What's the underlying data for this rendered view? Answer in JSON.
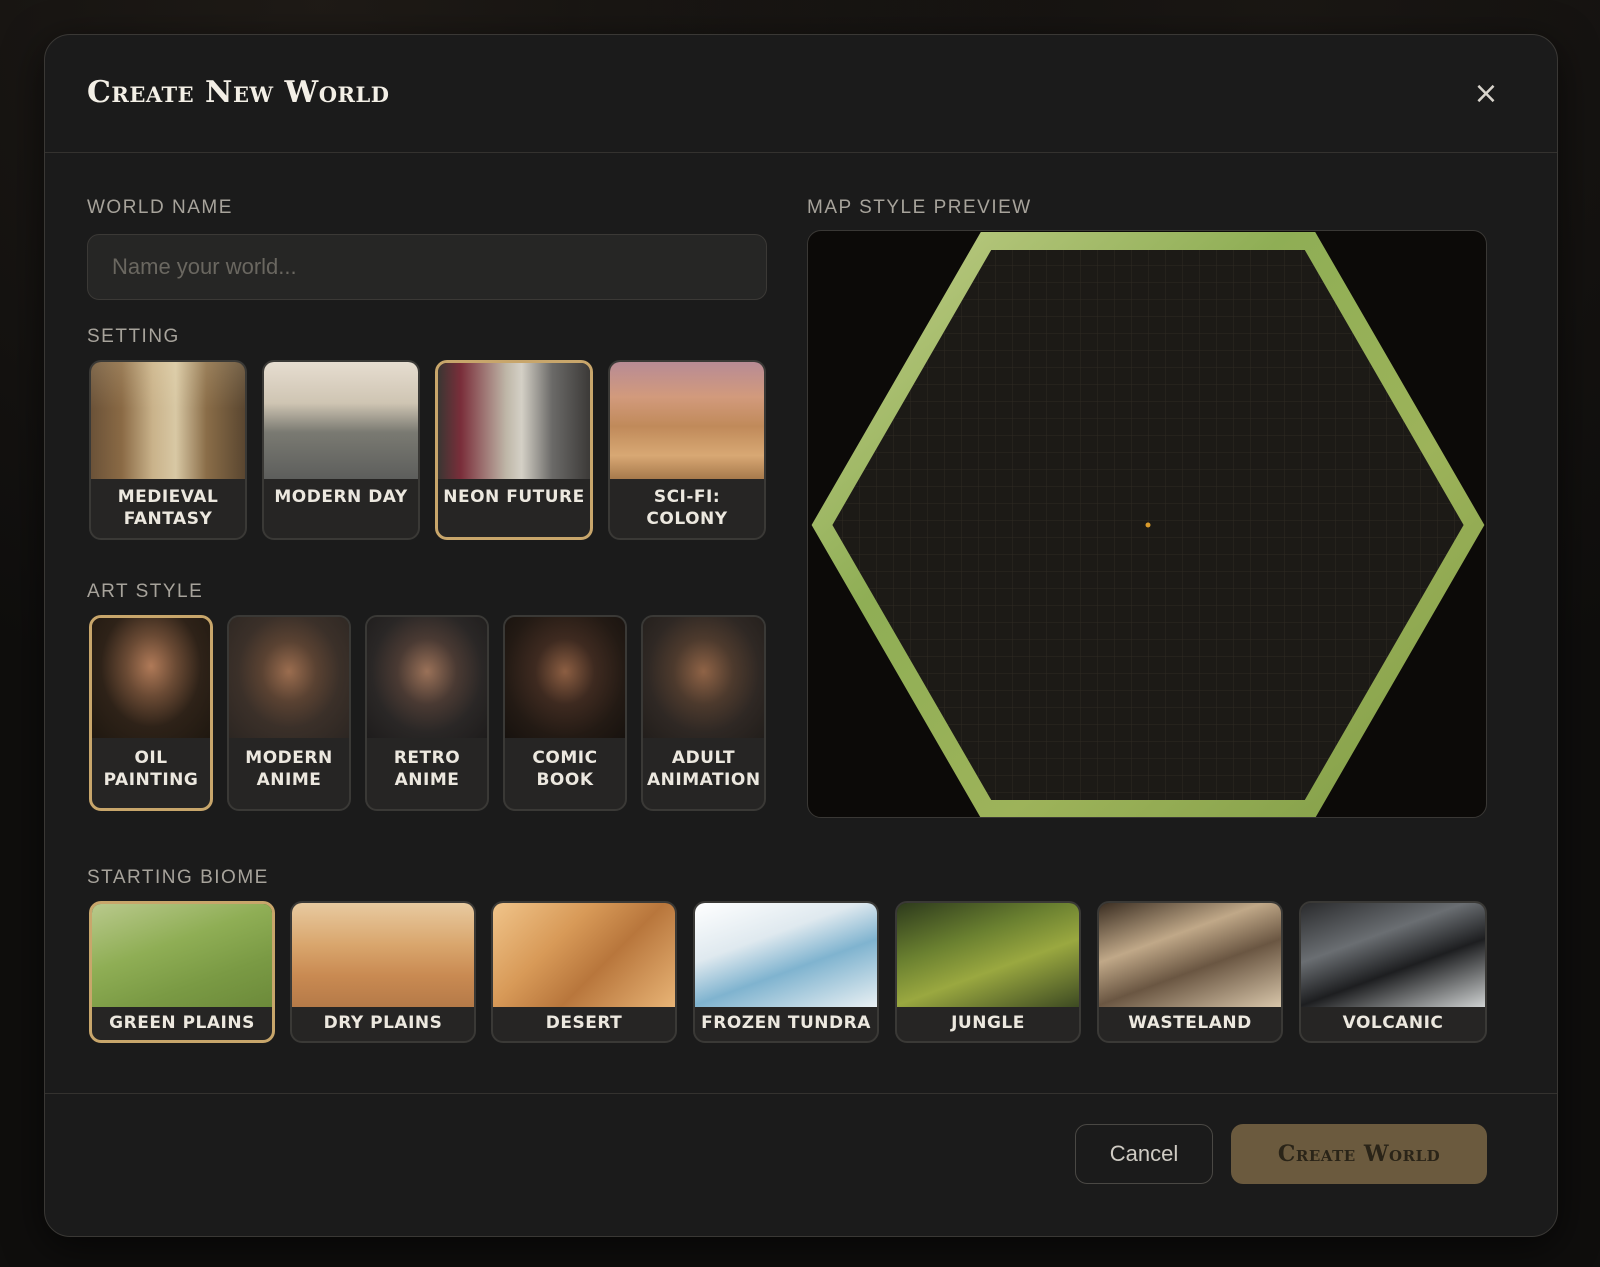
{
  "dialog": {
    "title": "Create New World",
    "close_label": "×"
  },
  "world_name": {
    "label": "World Name",
    "placeholder": "Name your world...",
    "value": ""
  },
  "setting": {
    "label": "Setting",
    "selected": "Neon Future",
    "options": [
      {
        "label": "Medieval Fantasy"
      },
      {
        "label": "Modern Day"
      },
      {
        "label": "Neon Future"
      },
      {
        "label": "Sci-Fi: Colony"
      }
    ]
  },
  "art_style": {
    "label": "Art Style",
    "selected": "Oil Painting",
    "options": [
      {
        "label": "Oil Painting"
      },
      {
        "label": "Modern Anime"
      },
      {
        "label": "Retro Anime"
      },
      {
        "label": "Comic Book"
      },
      {
        "label": "Adult Animation"
      }
    ]
  },
  "map_preview": {
    "label": "Map Style Preview",
    "border_color": "#8fae55",
    "marker_color": "#d99a2b"
  },
  "starting_biome": {
    "label": "Starting Biome",
    "selected": "Green Plains",
    "options": [
      {
        "label": "Green Plains"
      },
      {
        "label": "Dry Plains"
      },
      {
        "label": "Desert"
      },
      {
        "label": "Frozen Tundra"
      },
      {
        "label": "Jungle"
      },
      {
        "label": "Wasteland"
      },
      {
        "label": "Volcanic"
      }
    ]
  },
  "footer": {
    "cancel_label": "Cancel",
    "create_label": "Create World"
  },
  "colors": {
    "accent": "#c8a66b",
    "primary_button": "#6b5a3e",
    "background": "#1b1b1b"
  }
}
